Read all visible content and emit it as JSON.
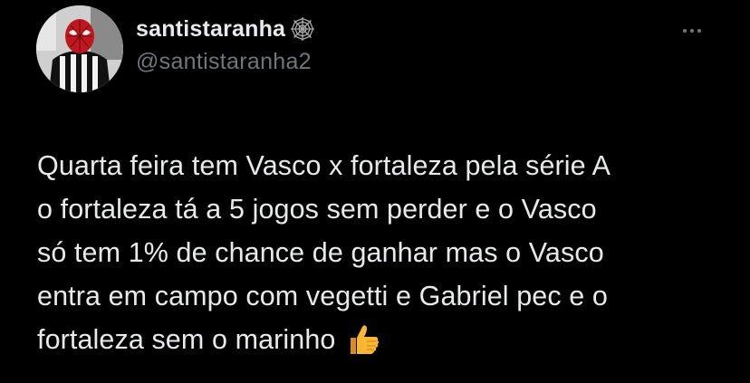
{
  "author": {
    "display_name": "santistaranha",
    "handle": "@santistaranha2",
    "name_icon": "spider-web-icon",
    "avatar": "spiderman-santos-jersey-avatar"
  },
  "actions": {
    "more_icon": "more-options-icon"
  },
  "tweet": {
    "lines": [
      "Quarta feira tem Vasco x fortaleza pela série A",
      "o fortaleza tá a 5 jogos sem perder e o Vasco",
      "só tem 1% de chance de ganhar mas o Vasco",
      "entra em campo com vegetti e Gabriel pec e o",
      "fortaleza sem o marinho"
    ],
    "emoji": "thumbs-up-icon"
  },
  "colors": {
    "background": "#000000",
    "text_primary": "#e7e9ea",
    "text_secondary": "#71767b",
    "emoji": "#f7b733"
  }
}
